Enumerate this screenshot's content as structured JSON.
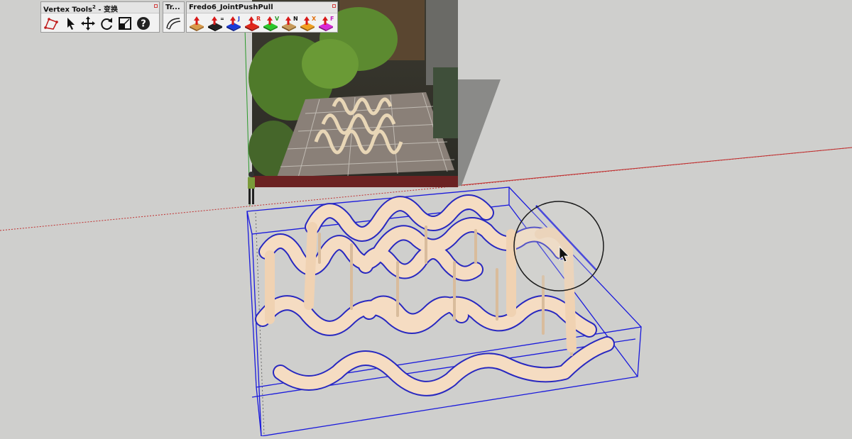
{
  "app": "SketchUp",
  "toolbars": [
    {
      "title": "Vertex Tools",
      "title_suffix": " - 变换",
      "superscript": "2",
      "buttons": [
        {
          "icon": "vertex-select-icon"
        },
        {
          "icon": "pointer-arrow-icon"
        },
        {
          "icon": "move-icon"
        },
        {
          "icon": "rotate-icon"
        },
        {
          "icon": "scale-icon"
        },
        {
          "icon": "help-icon"
        }
      ]
    },
    {
      "title": "Tr...",
      "buttons": [
        {
          "icon": "curve-tool-icon"
        }
      ]
    },
    {
      "title": "Fredo6_JointPushPull",
      "buttons": [
        {
          "icon": "joint-pushpull-icon",
          "letter": ""
        },
        {
          "icon": "joint-pushpull-equal-icon",
          "letter": "="
        },
        {
          "icon": "joint-pushpull-j-icon",
          "letter": "J"
        },
        {
          "icon": "joint-pushpull-r-icon",
          "letter": "R"
        },
        {
          "icon": "joint-pushpull-v-icon",
          "letter": "V"
        },
        {
          "icon": "joint-pushpull-n-icon",
          "letter": "N"
        },
        {
          "icon": "joint-pushpull-x-icon",
          "letter": "X"
        },
        {
          "icon": "joint-pushpull-f-icon",
          "letter": "F"
        }
      ]
    }
  ],
  "colors": {
    "background": "#cfcfcd",
    "selection_box": "#1a1adc",
    "ribbon_fill": "#f5dcc2",
    "ribbon_shade": "#d9bc9c",
    "red_axis": "#c03030",
    "green_axis": "#2a9a2a",
    "blue_axis": "#2a2ad0"
  }
}
